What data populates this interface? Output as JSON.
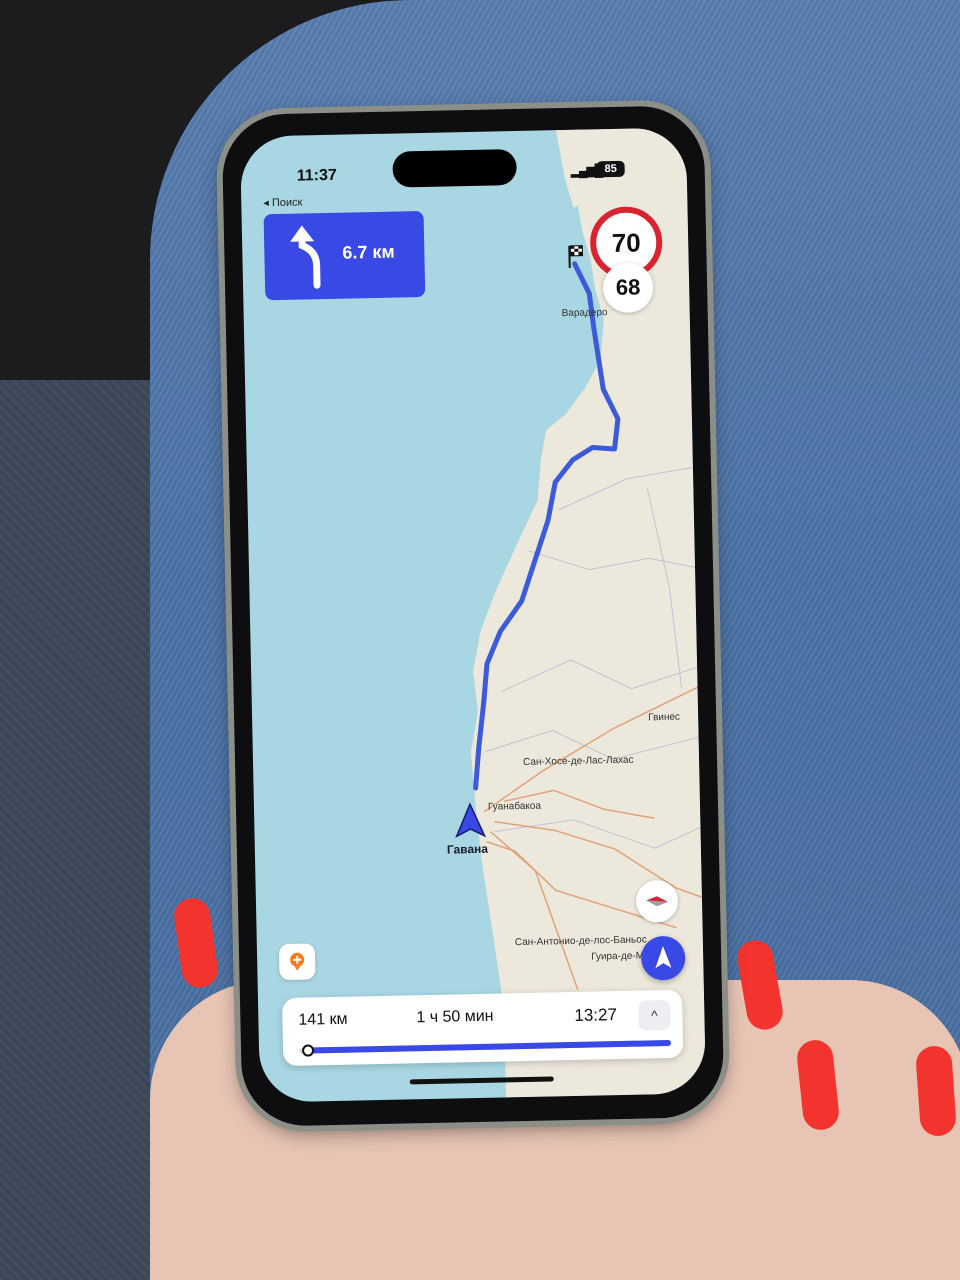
{
  "status_bar": {
    "time": "11:37",
    "back_label": "◂ Поиск",
    "signal": "▂▄▆█",
    "battery": "85"
  },
  "maneuver": {
    "icon": "turn-left-arrow-icon",
    "distance": "6.7 км"
  },
  "speed": {
    "limit": "70",
    "current": "68"
  },
  "map": {
    "labels": {
      "destination": "Варадеро",
      "origin": "Гавана",
      "guanabacoa": "Гуанабакоа",
      "san_jose": "Сан-Хосе-де-Лас-Лахас",
      "guines": "Гвинес",
      "san_antonio": "Сан-Антонио-де-лос-Баньос",
      "guira": "Гуира-де-Мелена"
    },
    "colors": {
      "sea": "#a8d7e3",
      "land": "#ede8dc",
      "route": "#3b5bdb",
      "accent": "#3949e6"
    }
  },
  "route_panel": {
    "distance": "141 км",
    "duration": "1 ч 50 мин",
    "arrival": "13:27",
    "expand_icon": "^",
    "progress": 0.02
  }
}
